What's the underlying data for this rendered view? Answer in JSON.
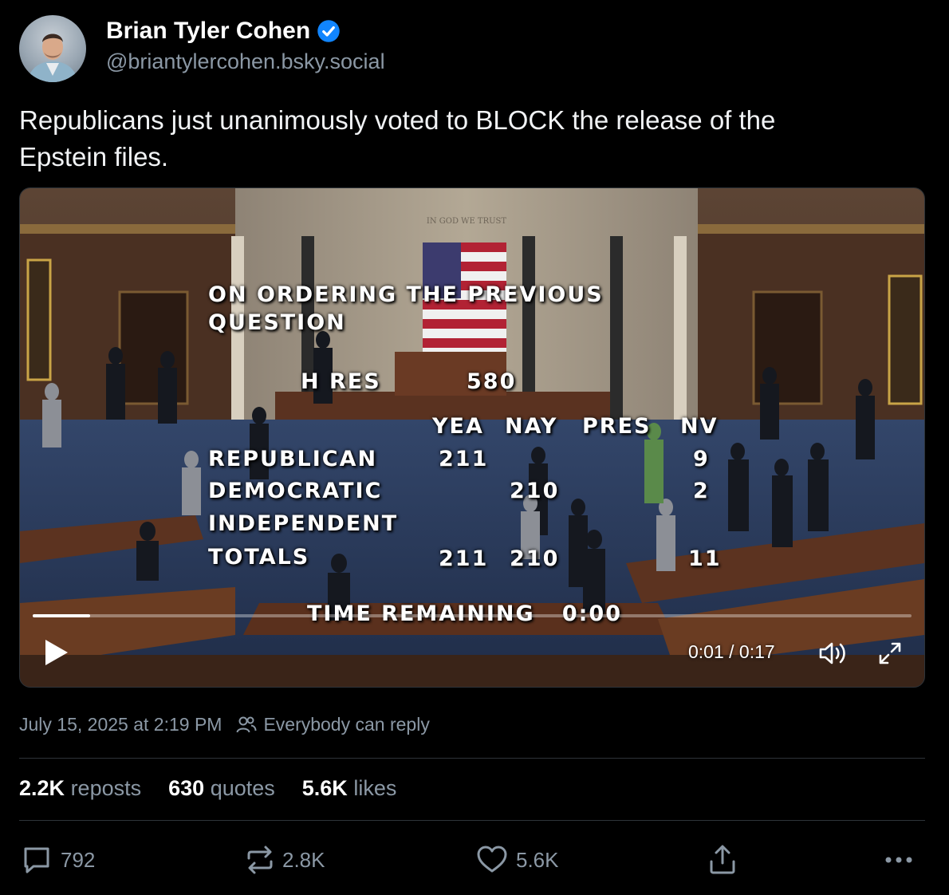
{
  "author": {
    "display_name": "Brian Tyler Cohen",
    "handle": "@briantylercohen.bsky.social",
    "verified_icon": "verified-badge-icon"
  },
  "post": {
    "text_line1": "Republicans just unanimously voted to BLOCK the release of the",
    "text_line2": "Epstein files."
  },
  "video": {
    "overlay": {
      "motto": "IN GOD WE TRUST",
      "title_line1": "ON ORDERING THE PREVIOUS",
      "title_line2": "QUESTION",
      "measure_label": "H RES",
      "measure_number": "580",
      "col_yea": "YEA",
      "col_nay": "NAY",
      "col_pres": "PRES",
      "col_nv": "NV",
      "row_republican": "REPUBLICAN",
      "row_democratic": "DEMOCRATIC",
      "row_independent": "INDEPENDENT",
      "row_totals": "TOTALS",
      "rep_yea": "211",
      "rep_nv": "9",
      "dem_nay": "210",
      "dem_nv": "2",
      "tot_yea": "211",
      "tot_nay": "210",
      "tot_nv": "11",
      "time_remaining": "TIME REMAINING   0:00"
    },
    "progress_fraction": 0.065,
    "time_readout": "0:01 / 0:17",
    "controls": {
      "play_icon": "play-icon",
      "volume_icon": "volume-icon",
      "fullscreen_icon": "fullscreen-icon"
    }
  },
  "meta": {
    "timestamp": "July 15, 2025 at 2:19 PM",
    "reply_setting": "Everybody can reply"
  },
  "stats": {
    "reposts_count": "2.2K",
    "reposts_label": "reposts",
    "quotes_count": "630",
    "quotes_label": "quotes",
    "likes_count": "5.6K",
    "likes_label": "likes"
  },
  "actions": {
    "reply_count": "792",
    "repost_count": "2.8K",
    "like_count": "5.6K"
  },
  "colors": {
    "background": "#000000",
    "secondary_text": "#8b98a5",
    "verified_blue": "#1185fe"
  }
}
